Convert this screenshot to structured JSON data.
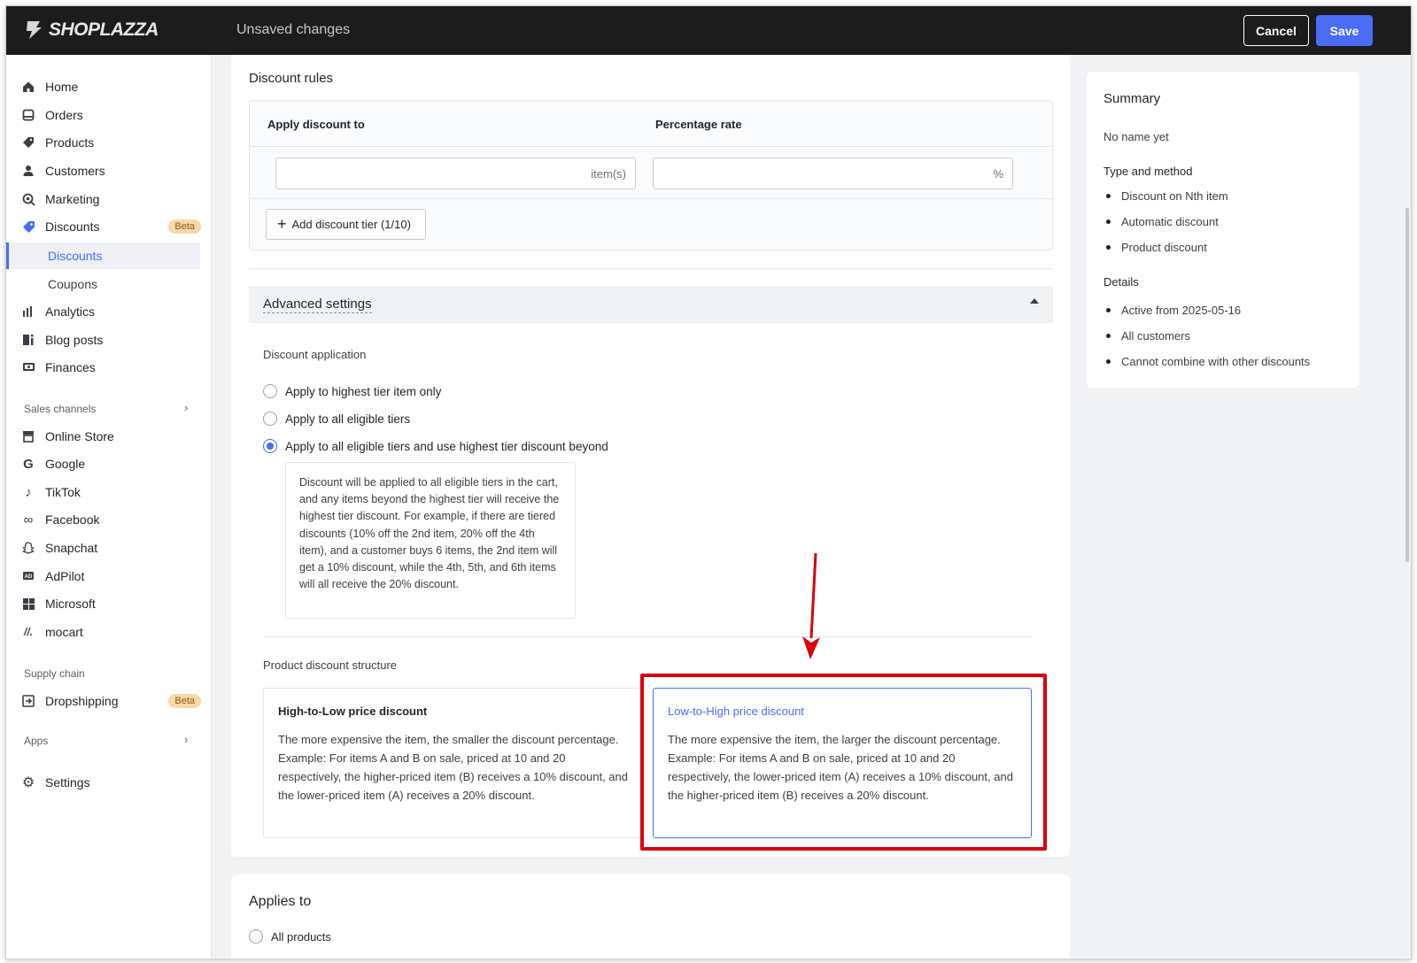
{
  "topbar": {
    "brand": "SHOPLAZZA",
    "status": "Unsaved changes",
    "cancel_label": "Cancel",
    "save_label": "Save"
  },
  "sidebar": {
    "items": [
      {
        "label": "Home",
        "icon": "home-icon"
      },
      {
        "label": "Orders",
        "icon": "orders-icon"
      },
      {
        "label": "Products",
        "icon": "tag-icon"
      },
      {
        "label": "Customers",
        "icon": "person-icon"
      },
      {
        "label": "Marketing",
        "icon": "marketing-icon"
      },
      {
        "label": "Discounts",
        "icon": "discount-tag-icon",
        "badge": "Beta"
      }
    ],
    "discount_subitems": [
      {
        "label": "Discounts",
        "active": true
      },
      {
        "label": "Coupons",
        "active": false
      }
    ],
    "items2": [
      {
        "label": "Analytics",
        "icon": "bar-chart-icon"
      },
      {
        "label": "Blog posts",
        "icon": "blog-icon"
      },
      {
        "label": "Finances",
        "icon": "finances-icon"
      }
    ],
    "sales_channels_label": "Sales channels",
    "channels": [
      {
        "label": "Online Store",
        "icon": "store-icon"
      },
      {
        "label": "Google",
        "icon": "google-icon"
      },
      {
        "label": "TikTok",
        "icon": "tiktok-icon"
      },
      {
        "label": "Facebook",
        "icon": "meta-icon"
      },
      {
        "label": "Snapchat",
        "icon": "snapchat-icon"
      },
      {
        "label": "AdPilot",
        "icon": "adpilot-icon"
      },
      {
        "label": "Microsoft",
        "icon": "microsoft-icon"
      },
      {
        "label": "mocart",
        "icon": "mocart-icon"
      }
    ],
    "supply_chain_label": "Supply chain",
    "dropshipping": {
      "label": "Dropshipping",
      "badge": "Beta"
    },
    "apps_label": "Apps",
    "settings_label": "Settings"
  },
  "discount_rules": {
    "title": "Discount rules",
    "col_apply": "Apply discount to",
    "col_rate": "Percentage rate",
    "items_suffix": "item(s)",
    "rate_suffix": "%",
    "items_value": "",
    "rate_value": "",
    "add_tier_label": "Add discount tier (1/10)"
  },
  "advanced": {
    "title": "Advanced settings",
    "application_label": "Discount application",
    "options": [
      {
        "label": "Apply to highest tier item only",
        "selected": false
      },
      {
        "label": "Apply to all eligible tiers",
        "selected": false
      },
      {
        "label": "Apply to all eligible tiers and use highest tier discount beyond",
        "selected": true
      }
    ],
    "note": "Discount will be applied to all eligible tiers in the cart, and any items beyond the highest tier will receive the highest tier discount. For example, if there are tiered discounts (10% off the 2nd item, 20% off the 4th item), and a customer buys 6 items, the 2nd item will get a 10% discount, while the 4th, 5th, and 6th items will all receive the 20% discount.",
    "structure_label": "Product discount structure",
    "structures": [
      {
        "title": "High-to-Low price discount",
        "body": "The more expensive the item, the smaller the discount percentage.\nExample: For items A and B on sale, priced at 10 and 20 respectively, the higher-priced item (B) receives a 10% discount, and the lower-priced item (A) receives a 20% discount.",
        "selected": false
      },
      {
        "title": "Low-to-High price discount",
        "body": "The more expensive the item, the larger the discount percentage.\nExample: For items A and B on sale, priced at 10 and 20 respectively, the lower-priced item (A) receives a 10% discount, and the higher-priced item (B) receives a 20% discount.",
        "selected": true
      }
    ]
  },
  "applies_to": {
    "title": "Applies to",
    "first_option": "All products"
  },
  "summary": {
    "title": "Summary",
    "name": "No name yet",
    "type_heading": "Type and method",
    "type_items": [
      "Discount on Nth item",
      "Automatic discount",
      "Product discount"
    ],
    "details_heading": "Details",
    "detail_items": [
      "Active from 2025-05-16",
      "All customers",
      "Cannot combine with other discounts"
    ]
  },
  "colors": {
    "accent": "#4a6cf7",
    "highlight": "#d9000d",
    "topbar": "#1c1c1c",
    "badge": "#f7d9a8"
  }
}
